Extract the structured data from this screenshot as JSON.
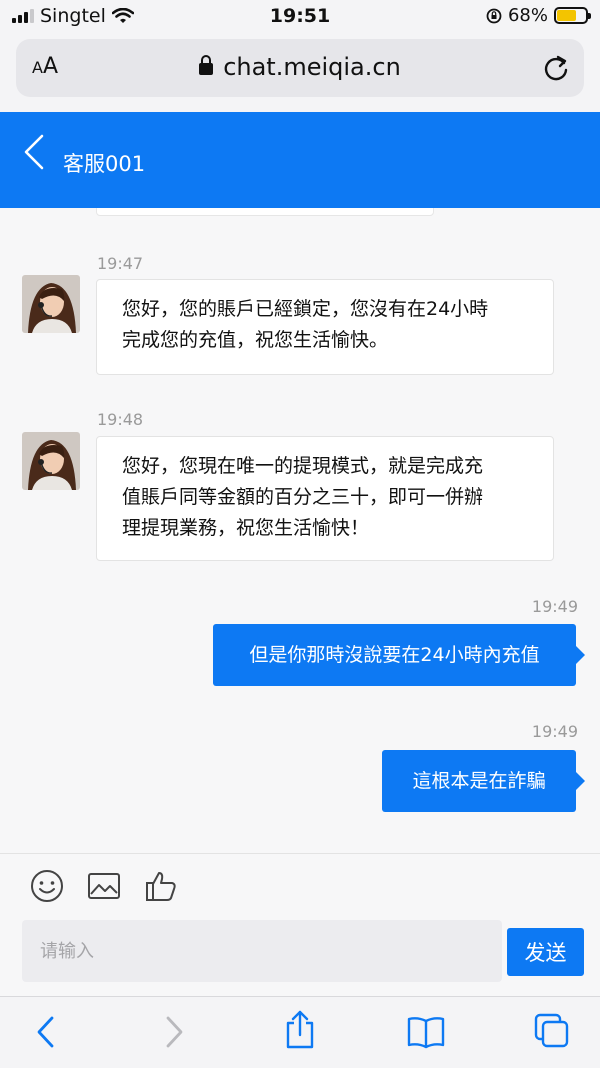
{
  "status_bar": {
    "carrier": "Singtel",
    "time": "19:51",
    "battery": "68%",
    "battery_level": 0.68
  },
  "browser": {
    "text_size_label": "AA",
    "url": "chat.meiqia.cn"
  },
  "header": {
    "title": "客服001"
  },
  "messages": [
    {
      "direction": "incoming",
      "time": "19:47",
      "lines": [
        "您好，您的賬戶已經鎖定，您沒有在24小時",
        "完成您的充值，祝您生活愉快。"
      ]
    },
    {
      "direction": "incoming",
      "time": "19:48",
      "lines": [
        "您好，您現在唯一的提現模式，就是完成充",
        "值賬戶同等金額的百分之三十，即可一併辦",
        "理提現業務，祝您生活愉快！"
      ]
    },
    {
      "direction": "outgoing",
      "time": "19:49",
      "text": "但是你那時沒說要在24小時內充值"
    },
    {
      "direction": "outgoing",
      "time": "19:49",
      "text": "這根本是在詐騙"
    }
  ],
  "input": {
    "placeholder": "请输入",
    "send_label": "发送"
  },
  "icons": {
    "signal": "signal-icon",
    "wifi": "wifi-icon",
    "orientation_lock": "orientation-lock-icon",
    "battery": "battery-icon",
    "lock": "lock-icon",
    "reload": "reload-icon",
    "back": "chevron-left-icon",
    "emoji": "emoji-icon",
    "image": "image-icon",
    "like": "thumbs-up-icon",
    "safari_back": "safari-back-icon",
    "safari_forward": "safari-forward-icon",
    "share": "share-icon",
    "bookmarks": "bookmarks-icon",
    "tabs": "tabs-icon"
  },
  "colors": {
    "accent": "#0d79f3",
    "battery": "#f3c400"
  }
}
